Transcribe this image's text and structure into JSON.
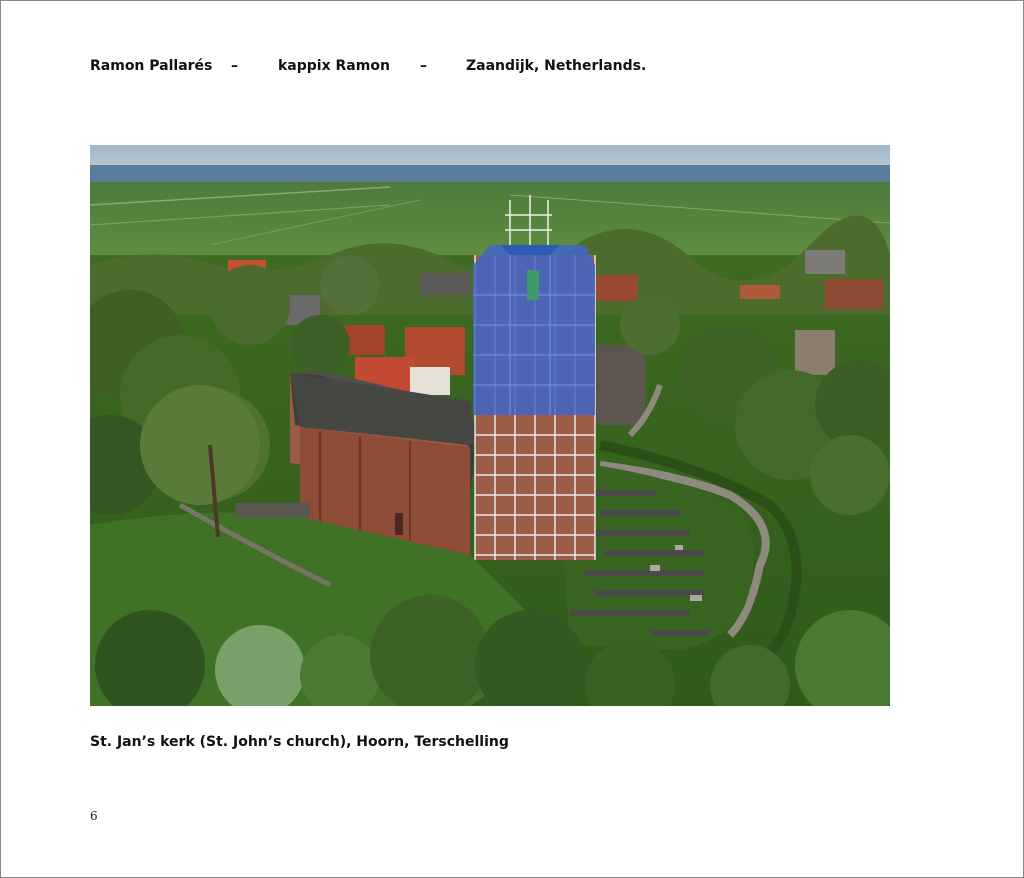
{
  "header": {
    "author": "Ramon Pallarés",
    "sep1": "–",
    "alias": "kappix Ramon",
    "sep2": "–",
    "location": "Zaandijk,  Netherlands."
  },
  "photo": {
    "subject": "aerial-photo-church-scaffolding"
  },
  "caption": "St. Jan’s kerk (St. John’s church), Hoorn, Terschelling",
  "page_number": "6"
}
